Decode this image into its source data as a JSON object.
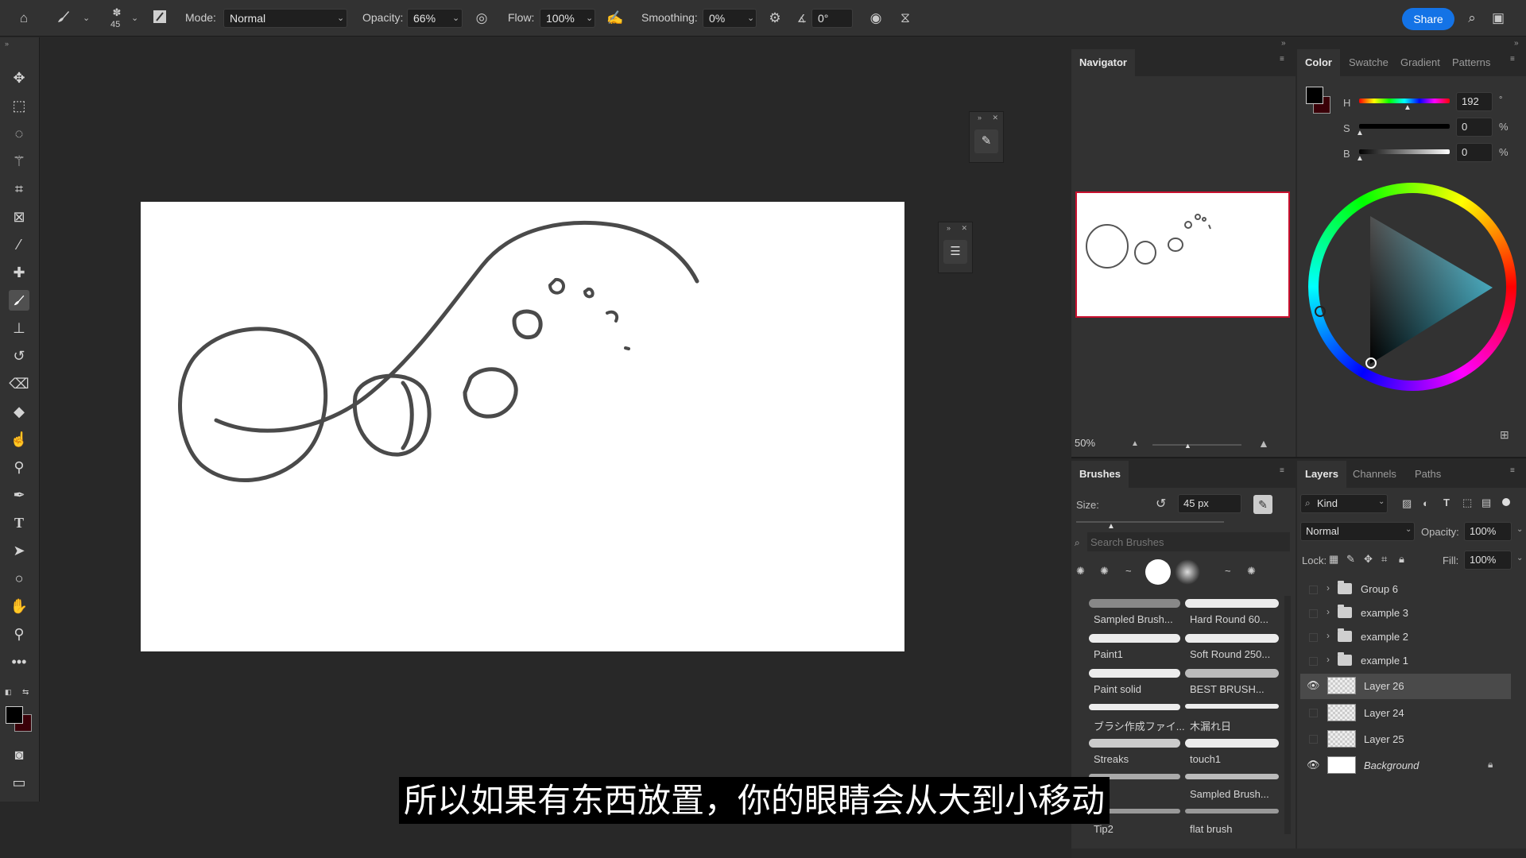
{
  "options_bar": {
    "brush_size": "45",
    "mode_label": "Mode:",
    "mode_value": "Normal",
    "opacity_label": "Opacity:",
    "opacity_value": "66%",
    "flow_label": "Flow:",
    "flow_value": "100%",
    "smoothing_label": "Smoothing:",
    "smoothing_value": "0%",
    "angle_value": "0°",
    "share_label": "Share"
  },
  "navigator": {
    "tab": "Navigator",
    "zoom": "50%"
  },
  "color_panel": {
    "tabs": [
      "Color",
      "Swatche",
      "Gradient",
      "Patterns"
    ],
    "h_label": "H",
    "h_value": "192",
    "h_unit": "°",
    "s_label": "S",
    "s_value": "0",
    "s_unit": "%",
    "b_label": "B",
    "b_value": "0",
    "b_unit": "%",
    "foreground": "#000000",
    "background": "#3a0008"
  },
  "brushes": {
    "tab": "Brushes",
    "size_label": "Size:",
    "size_value": "45 px",
    "search_placeholder": "Search Brushes",
    "items": [
      "Sampled Brush...",
      "Hard Round 60...",
      "Paint1",
      "Soft Round 250...",
      "Paint solid",
      "BEST BRUSH...",
      "ブラシ作成ファイ...",
      "木漏れ日",
      "Streaks",
      "touch1",
      "",
      "Sampled Brush...",
      "Tip2",
      "flat brush"
    ]
  },
  "layers": {
    "tabs": [
      "Layers",
      "Channels",
      "Paths"
    ],
    "kind_label": "Kind",
    "blend_mode": "Normal",
    "opacity_label": "Opacity:",
    "opacity_value": "100%",
    "lock_label": "Lock:",
    "fill_label": "Fill:",
    "fill_value": "100%",
    "items": [
      {
        "name": "Group 6",
        "type": "group",
        "visible": false
      },
      {
        "name": "example 3",
        "type": "group",
        "visible": false
      },
      {
        "name": "example 2",
        "type": "group",
        "visible": false
      },
      {
        "name": "example 1",
        "type": "group",
        "visible": false
      },
      {
        "name": "Layer 26",
        "type": "layer",
        "visible": true,
        "selected": true
      },
      {
        "name": "Layer 24",
        "type": "layer",
        "visible": false
      },
      {
        "name": "Layer 25",
        "type": "layer",
        "visible": false
      },
      {
        "name": "Background",
        "type": "background",
        "visible": true,
        "locked": true
      }
    ]
  },
  "subtitle": "所以如果有东西放置，你的眼睛会从大到小移动"
}
